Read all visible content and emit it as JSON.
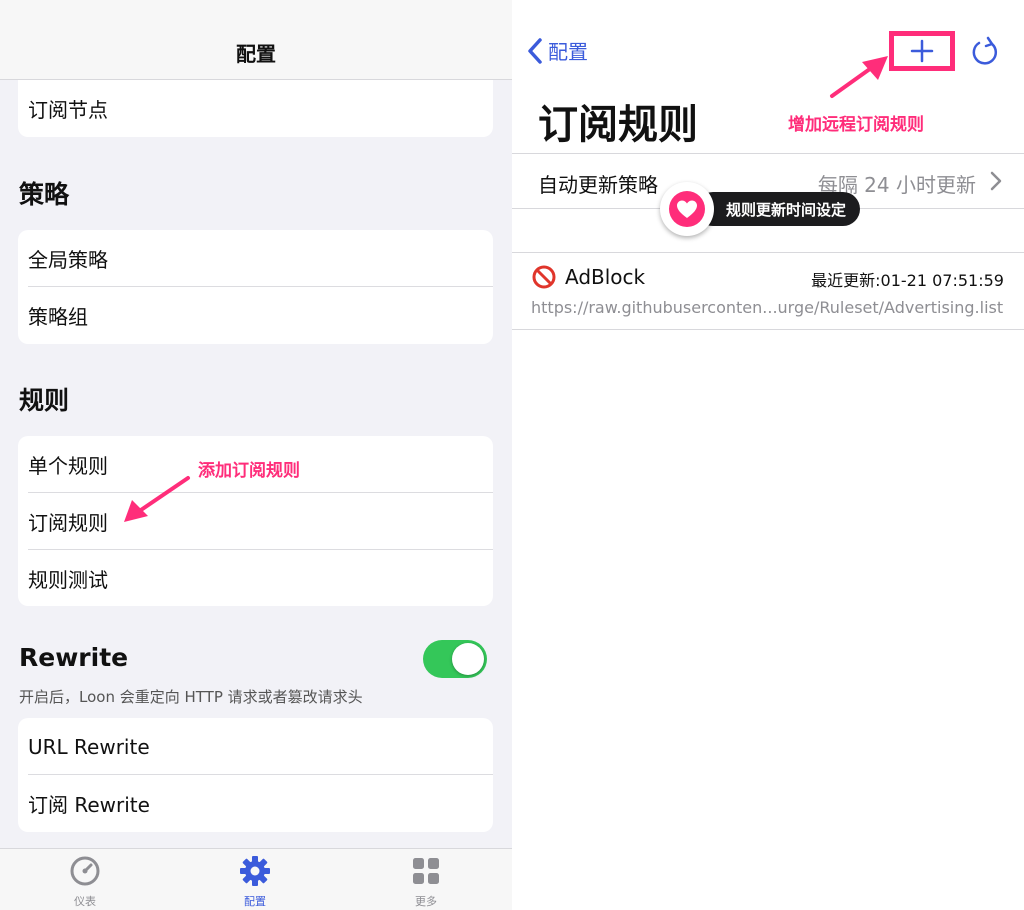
{
  "left": {
    "nav_title": "配置",
    "subscribe_nodes": "订阅节点",
    "sections": {
      "policy": {
        "title": "策略",
        "items": [
          "全局策略",
          "策略组"
        ]
      },
      "rules": {
        "title": "规则",
        "items": [
          "单个规则",
          "订阅规则",
          "规则测试"
        ]
      },
      "rewrite": {
        "title": "Rewrite",
        "enabled": true,
        "description": "开启后，Loon 会重定向 HTTP 请求或者篡改请求头",
        "items": [
          "URL Rewrite",
          "订阅 Rewrite"
        ]
      }
    },
    "annotation": "添加订阅规则",
    "tabs": [
      {
        "label": "仪表",
        "icon": "dashboard-icon"
      },
      {
        "label": "配置",
        "icon": "gear-icon"
      },
      {
        "label": "更多",
        "icon": "grid-icon"
      }
    ]
  },
  "right": {
    "back_label": "配置",
    "title": "订阅规则",
    "annotation": "增加远程订阅规则",
    "update_policy": {
      "label": "自动更新策略",
      "value": "每隔 24 小时更新"
    },
    "tooltip": "规则更新时间设定",
    "rules": [
      {
        "name": "AdBlock",
        "updated": "最近更新:01-21 07:51:59",
        "url": "https://raw.githubuserconten...urge/Ruleset/Advertising.list"
      }
    ]
  },
  "colors": {
    "accent": "#3b5bdb",
    "annotation": "#ff2d7a",
    "toggle_on": "#34c759"
  }
}
